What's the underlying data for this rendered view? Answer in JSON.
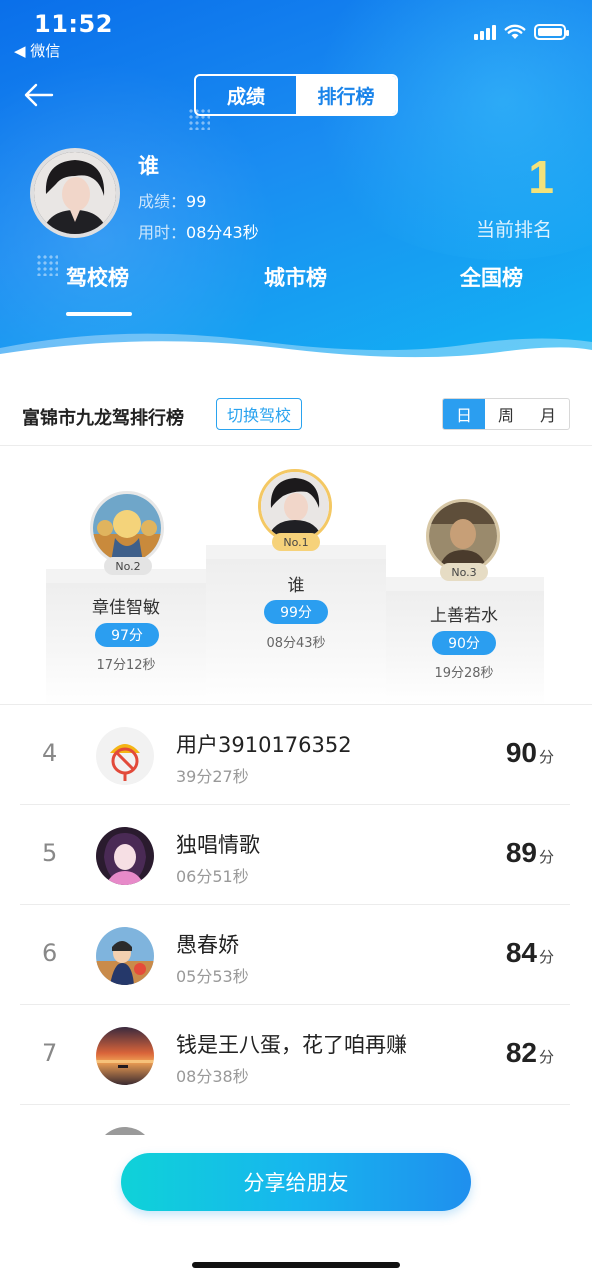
{
  "status_bar": {
    "time": "11:52",
    "back_app": "◀ 微信"
  },
  "nav": {
    "segments": [
      "成绩",
      "排行榜"
    ],
    "active_segment": 1
  },
  "me": {
    "name": "谁",
    "score_label": "成绩：",
    "score": "99",
    "time_label": "用时：",
    "time": "08分43秒",
    "rank": "1",
    "rank_label": "当前排名"
  },
  "tabs": [
    "驾校榜",
    "城市榜",
    "全国榜"
  ],
  "active_tab": 0,
  "board": {
    "title": "富锦市九龙驾排行榜",
    "switch_label": "切换驾校",
    "periods": [
      "日",
      "周",
      "月"
    ],
    "active_period": 0
  },
  "podium": {
    "first": {
      "badge": "No.1",
      "name": "谁",
      "score": "99分",
      "time": "08分43秒"
    },
    "second": {
      "badge": "No.2",
      "name": "章佳智敏",
      "score": "97分",
      "time": "17分12秒"
    },
    "third": {
      "badge": "No.3",
      "name": "上善若水",
      "score": "90分",
      "time": "19分28秒"
    }
  },
  "list": [
    {
      "rank": "4",
      "name": "用户3910176352",
      "time": "39分27秒",
      "score": "90",
      "unit": "分"
    },
    {
      "rank": "5",
      "name": "独唱情歌",
      "time": "06分51秒",
      "score": "89",
      "unit": "分"
    },
    {
      "rank": "6",
      "name": "愚春娇",
      "time": "05分53秒",
      "score": "84",
      "unit": "分"
    },
    {
      "rank": "7",
      "name": "钱是王八蛋，花了咱再赚",
      "time": "08分38秒",
      "score": "82",
      "unit": "分"
    }
  ],
  "share_button": "分享给朋友",
  "colors": {
    "primary": "#1a8df2",
    "accent": "#2b9ef0",
    "rank_gold": "#f3e27a"
  }
}
